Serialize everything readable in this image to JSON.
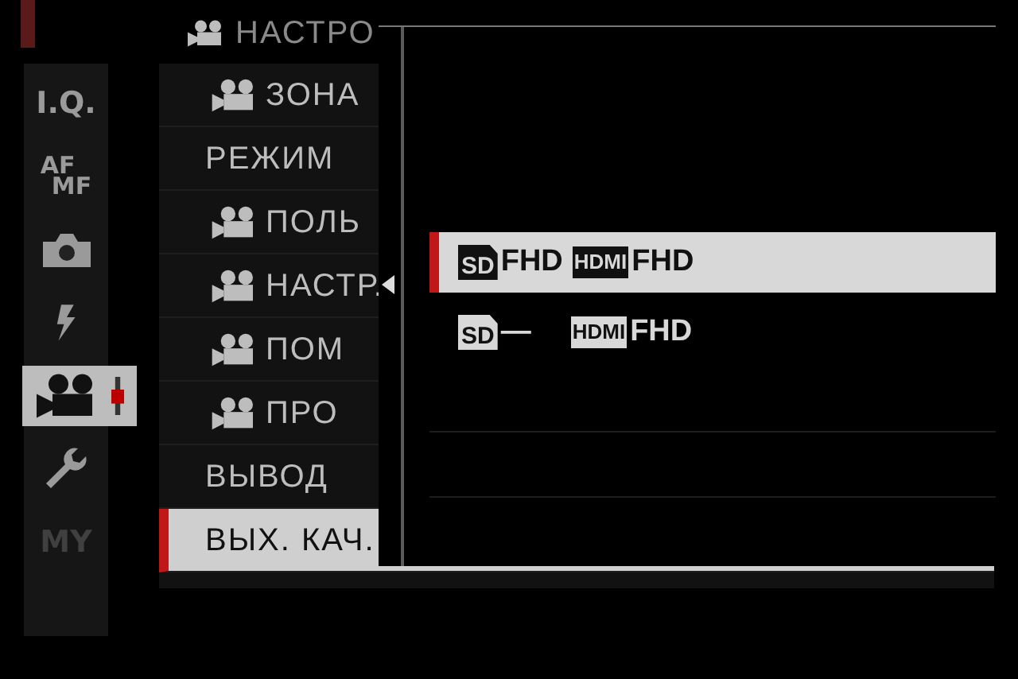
{
  "header": {
    "title": "НАСТРО"
  },
  "sidebar": {
    "items": [
      {
        "kind": "text",
        "label": "I.Q.",
        "selected": false,
        "disabled": false
      },
      {
        "kind": "afmf",
        "label": "AF",
        "sublabel": "MF",
        "selected": false,
        "disabled": false
      },
      {
        "kind": "camera",
        "selected": false,
        "disabled": false
      },
      {
        "kind": "flash",
        "selected": false,
        "disabled": false
      },
      {
        "kind": "video",
        "selected": true,
        "disabled": false
      },
      {
        "kind": "wrench",
        "selected": false,
        "disabled": false
      },
      {
        "kind": "text",
        "label": "MY",
        "selected": false,
        "disabled": true
      }
    ]
  },
  "menu": {
    "items": [
      {
        "video_icon": true,
        "label": "ЗОНА",
        "selected": false
      },
      {
        "video_icon": false,
        "label": "РЕЖИМ",
        "selected": false
      },
      {
        "video_icon": true,
        "label": "ПОЛЬ",
        "selected": false
      },
      {
        "video_icon": true,
        "label": "НАСТР.",
        "selected": false
      },
      {
        "video_icon": true,
        "label": "ПОМ",
        "selected": false
      },
      {
        "video_icon": true,
        "label": "ПРО",
        "selected": false
      },
      {
        "video_icon": false,
        "label": "ВЫВОД",
        "selected": false
      },
      {
        "video_icon": false,
        "label": "ВЫХ. КАЧ.",
        "selected": true
      }
    ]
  },
  "popup": {
    "options": [
      {
        "sd": "SD",
        "sd_value": "FHD",
        "hdmi": "HDMI",
        "hdmi_value": "FHD",
        "selected": true
      },
      {
        "sd": "SD",
        "sd_value": "—",
        "hdmi": "HDMI",
        "hdmi_value": "FHD",
        "selected": false
      }
    ]
  }
}
